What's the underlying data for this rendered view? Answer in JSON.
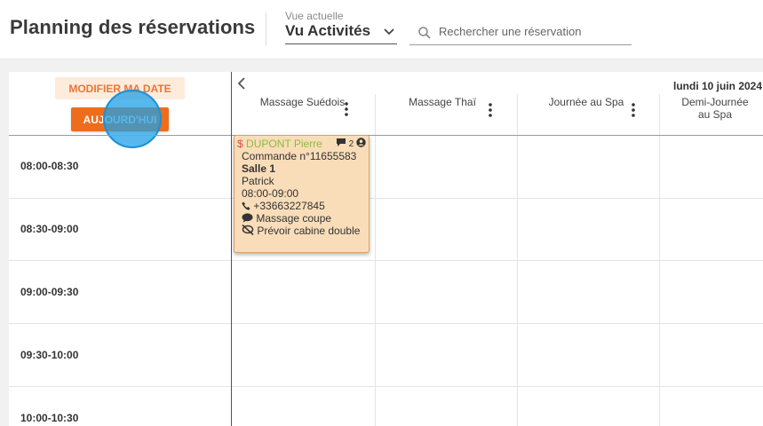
{
  "header": {
    "title": "Planning des réservations",
    "view_label": "Vue actuelle",
    "view_value": "Vu Activités",
    "search_placeholder": "Rechercher une réservation"
  },
  "toolbar": {
    "modify_date_label": "MODIFIER MA DATE",
    "today_label": "AUJOURD'HUI"
  },
  "calendar": {
    "date": "lundi 10 juin 2024",
    "columns": [
      {
        "title": "Massage Suédois"
      },
      {
        "title": "Massage Thaï"
      },
      {
        "title": "Journée au Spa"
      },
      {
        "title": "Demi-Journée au Spa"
      }
    ],
    "time_slots": [
      "08:00-08:30",
      "08:30-09:00",
      "09:00-09:30",
      "09:30-10:00",
      "10:00-10:30"
    ]
  },
  "event": {
    "dollar": "$",
    "customer": "DUPONT Pierre",
    "comment_count": "2",
    "order": "Commande n°11655583",
    "room": "Salle 1",
    "staff": "Patrick",
    "time": "08:00-09:00",
    "phone": "+33663227845",
    "comment": "Massage coupe",
    "note": "Prévoir cabine double"
  },
  "colors": {
    "accent_orange": "#ee6d1c",
    "soft_orange": "#fdebdc",
    "event_bg": "#f9ddb9",
    "customer_green": "#8bbd3a",
    "click_indicator": "#1ea0e6"
  }
}
